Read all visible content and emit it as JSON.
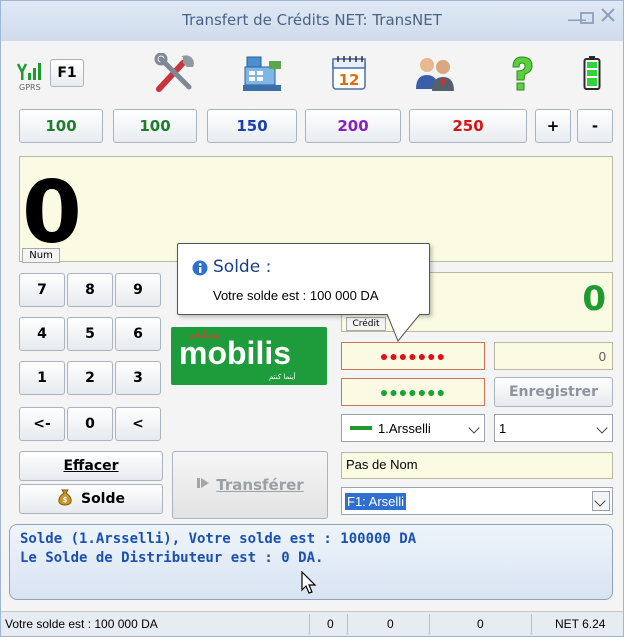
{
  "window": {
    "title": "Transfert de Crédits NET: TransNET"
  },
  "toolbar": {
    "signal_label": "GPRS",
    "f_key": "F1"
  },
  "amounts": [
    {
      "label": "100",
      "color": "#1f7d2e"
    },
    {
      "label": "100",
      "color": "#1f7d2e"
    },
    {
      "label": "150",
      "color": "#1c3fb0"
    },
    {
      "label": "200",
      "color": "#8a1fc0"
    },
    {
      "label": "250",
      "color": "#d61414"
    },
    {
      "label": "+",
      "color": "#000000"
    },
    {
      "label": "-",
      "color": "#000000"
    }
  ],
  "display": {
    "value": "0",
    "tag": "Num"
  },
  "keypad": {
    "rows": [
      [
        "7",
        "8",
        "9"
      ],
      [
        "4",
        "5",
        "6"
      ],
      [
        "1",
        "2",
        "3"
      ],
      [
        "<-",
        "0",
        "<"
      ]
    ],
    "clear_label": "Effacer",
    "balance_label": "Solde"
  },
  "transfer_label": "Transférer",
  "brand": {
    "name": "mobilis",
    "arabic": "موبيليس",
    "tagline": "أينما كنتم"
  },
  "credit": {
    "value": "0",
    "tag": "Crédit"
  },
  "fields": {
    "pin_red": "●●●●●●●",
    "pin_green": "●●●●●●●",
    "amount_right": "0",
    "save_label": "Enregistrer",
    "operator_select": "1.Arsselli",
    "count_select": "1",
    "name": "Pas de Nom",
    "profile_select": "F1: Arselli"
  },
  "tooltip": {
    "title": "Solde :",
    "text": "Votre solde est : 100 000 DA"
  },
  "message": {
    "line1": "Solde (1.Arsselli), Votre solde est : 100000 DA",
    "line2": "Le Solde de Distributeur est : 0 DA."
  },
  "statusbar": {
    "text": "Votre solde est : 100 000 DA",
    "c1": "0",
    "c2": "0",
    "c3": "0",
    "version": "NET 6.24"
  }
}
